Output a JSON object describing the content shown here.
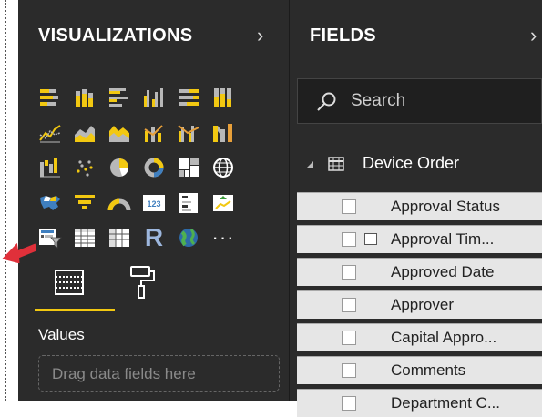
{
  "visualizations": {
    "title": "VISUALIZATIONS",
    "chevron": "›",
    "tiles": [
      {
        "icon": "stacked-bar-icon"
      },
      {
        "icon": "stacked-column-icon"
      },
      {
        "icon": "clustered-bar-icon"
      },
      {
        "icon": "clustered-column-icon"
      },
      {
        "icon": "100pct-stacked-bar-icon"
      },
      {
        "icon": "100pct-stacked-column-icon"
      },
      {
        "icon": "empty"
      },
      {
        "icon": "line-chart-icon"
      },
      {
        "icon": "area-chart-icon"
      },
      {
        "icon": "stacked-area-icon"
      },
      {
        "icon": "line-and-column-icon"
      },
      {
        "icon": "line-and-clustered-column-icon"
      },
      {
        "icon": "ribbon-chart-icon"
      },
      {
        "icon": "empty"
      },
      {
        "icon": "waterfall-icon"
      },
      {
        "icon": "scatter-icon"
      },
      {
        "icon": "pie-icon"
      },
      {
        "icon": "donut-icon"
      },
      {
        "icon": "treemap-icon"
      },
      {
        "icon": "map-icon"
      },
      {
        "icon": "empty"
      },
      {
        "icon": "filled-map-icon"
      },
      {
        "icon": "funnel-icon"
      },
      {
        "icon": "gauge-icon"
      },
      {
        "icon": "card-icon",
        "text": "123"
      },
      {
        "icon": "multi-row-card-icon"
      },
      {
        "icon": "kpi-icon"
      },
      {
        "icon": "empty"
      },
      {
        "icon": "slicer-icon"
      },
      {
        "icon": "table-icon"
      },
      {
        "icon": "matrix-icon"
      },
      {
        "icon": "r-visual-icon",
        "text": "R"
      },
      {
        "icon": "globe-icon"
      },
      {
        "icon": "more-icon",
        "text": "···"
      },
      {
        "icon": "empty"
      }
    ],
    "values_label": "Values",
    "dropzone_text": "Drag data fields here"
  },
  "fields": {
    "title": "FIELDS",
    "chevron": "›",
    "search_placeholder": "Search",
    "table_name": "Device Order",
    "items": [
      {
        "label": "Approval Status",
        "datetime": false
      },
      {
        "label": "Approval Tim...",
        "datetime": true
      },
      {
        "label": "Approved Date",
        "datetime": false
      },
      {
        "label": "Approver",
        "datetime": false
      },
      {
        "label": "Capital Appro...",
        "datetime": false
      },
      {
        "label": "Comments",
        "datetime": false
      },
      {
        "label": "Department C...",
        "datetime": false
      }
    ]
  },
  "colors": {
    "accent": "#f2c811",
    "pane_bg": "#2b2b2b",
    "arrow": "#e0303a",
    "field_bg": "#e6e6e6"
  }
}
